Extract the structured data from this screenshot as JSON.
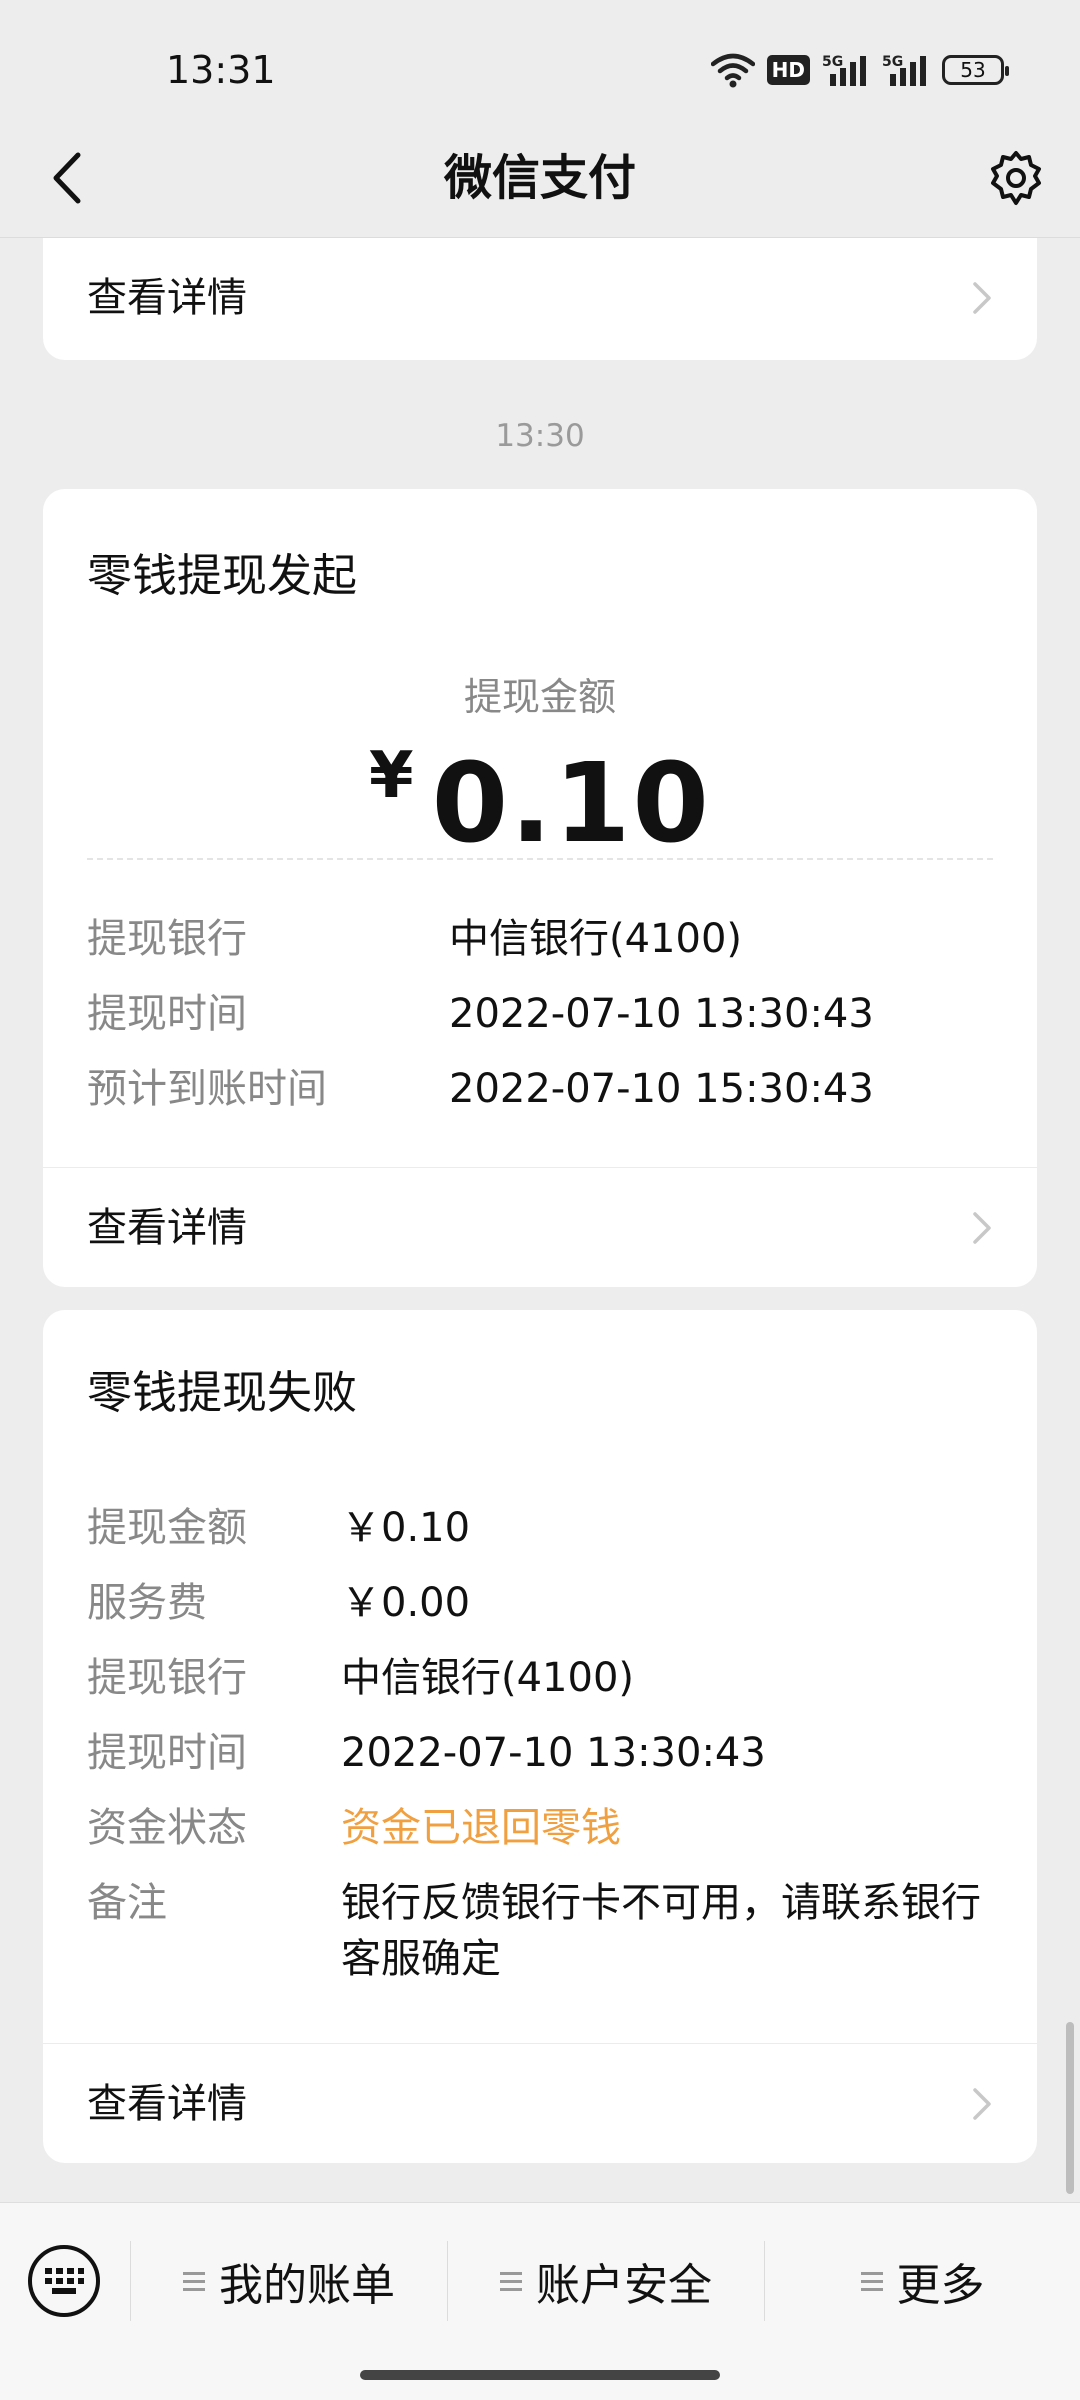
{
  "status_bar": {
    "time": "13:31",
    "hd_label": "HD",
    "battery": "53",
    "icons": [
      "wifi-icon",
      "hd-icon",
      "signal-5g-icon",
      "signal-5g-icon",
      "battery-icon"
    ]
  },
  "header": {
    "title": "微信支付",
    "back_icon": "chevron-left-icon",
    "settings_icon": "gear-icon"
  },
  "top_card": {
    "link_label": "查看详情"
  },
  "timestamp": "13:30",
  "withdraw_card": {
    "title": "零钱提现发起",
    "amount_caption": "提现金额",
    "currency": "¥",
    "amount": "0.10",
    "rows": [
      {
        "label": "提现银行",
        "value": "中信银行(4100)"
      },
      {
        "label": "提现时间",
        "value": "2022-07-10 13:30:43"
      },
      {
        "label": "预计到账时间",
        "value": "2022-07-10 15:30:43"
      }
    ],
    "link_label": "查看详情"
  },
  "failed_card": {
    "title": "零钱提现失败",
    "rows": [
      {
        "label": "提现金额",
        "value": "￥0.10"
      },
      {
        "label": "服务费",
        "value": "￥0.00"
      },
      {
        "label": "提现银行",
        "value": "中信银行(4100)"
      },
      {
        "label": "提现时间",
        "value": "2022-07-10 13:30:43"
      },
      {
        "label": "资金状态",
        "value": "资金已退回零钱"
      },
      {
        "label": "备注",
        "value": "银行反馈银行卡不可用，请联系银行客服确定"
      }
    ],
    "status_color": "#f0a040",
    "link_label": "查看详情"
  },
  "bottom_menu": {
    "keyboard_icon": "keyboard-icon",
    "items": [
      {
        "label": "我的账单"
      },
      {
        "label": "账户安全"
      },
      {
        "label": "更多"
      }
    ]
  }
}
